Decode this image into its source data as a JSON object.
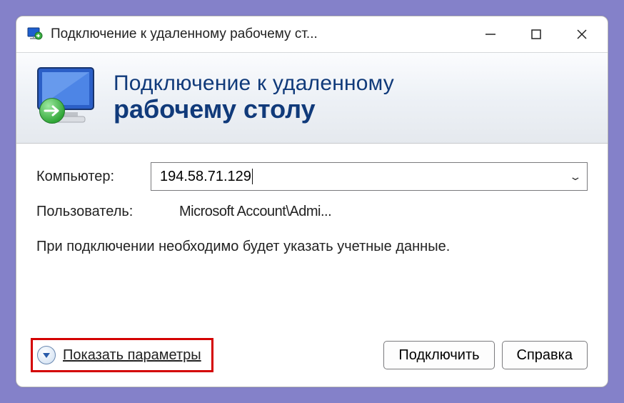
{
  "titlebar": {
    "title": "Подключение к удаленному рабочему ст..."
  },
  "banner": {
    "line1": "Подключение к удаленному",
    "line2": "рабочему столу"
  },
  "form": {
    "computer_label": "Компьютер:",
    "computer_value": "194.58.71.129",
    "user_label": "Пользователь:",
    "user_value": "Microsoft Account\\Admi...",
    "hint": "При подключении необходимо будет указать учетные данные."
  },
  "footer": {
    "options_label": "Показать параметры",
    "connect_label": "Подключить",
    "help_label": "Справка"
  }
}
